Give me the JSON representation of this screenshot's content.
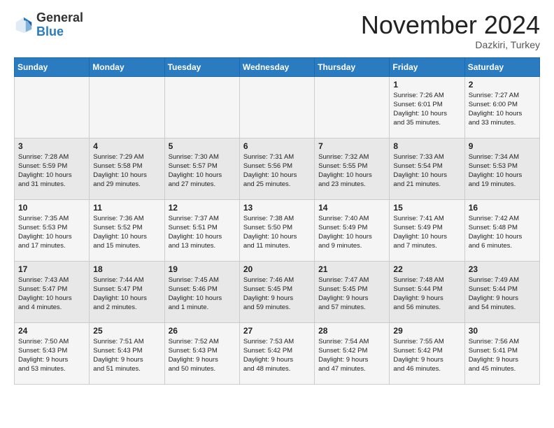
{
  "logo": {
    "general": "General",
    "blue": "Blue"
  },
  "header": {
    "month": "November 2024",
    "location": "Dazkiri, Turkey"
  },
  "weekdays": [
    "Sunday",
    "Monday",
    "Tuesday",
    "Wednesday",
    "Thursday",
    "Friday",
    "Saturday"
  ],
  "weeks": [
    [
      {
        "day": "",
        "info": ""
      },
      {
        "day": "",
        "info": ""
      },
      {
        "day": "",
        "info": ""
      },
      {
        "day": "",
        "info": ""
      },
      {
        "day": "",
        "info": ""
      },
      {
        "day": "1",
        "info": "Sunrise: 7:26 AM\nSunset: 6:01 PM\nDaylight: 10 hours\nand 35 minutes."
      },
      {
        "day": "2",
        "info": "Sunrise: 7:27 AM\nSunset: 6:00 PM\nDaylight: 10 hours\nand 33 minutes."
      }
    ],
    [
      {
        "day": "3",
        "info": "Sunrise: 7:28 AM\nSunset: 5:59 PM\nDaylight: 10 hours\nand 31 minutes."
      },
      {
        "day": "4",
        "info": "Sunrise: 7:29 AM\nSunset: 5:58 PM\nDaylight: 10 hours\nand 29 minutes."
      },
      {
        "day": "5",
        "info": "Sunrise: 7:30 AM\nSunset: 5:57 PM\nDaylight: 10 hours\nand 27 minutes."
      },
      {
        "day": "6",
        "info": "Sunrise: 7:31 AM\nSunset: 5:56 PM\nDaylight: 10 hours\nand 25 minutes."
      },
      {
        "day": "7",
        "info": "Sunrise: 7:32 AM\nSunset: 5:55 PM\nDaylight: 10 hours\nand 23 minutes."
      },
      {
        "day": "8",
        "info": "Sunrise: 7:33 AM\nSunset: 5:54 PM\nDaylight: 10 hours\nand 21 minutes."
      },
      {
        "day": "9",
        "info": "Sunrise: 7:34 AM\nSunset: 5:53 PM\nDaylight: 10 hours\nand 19 minutes."
      }
    ],
    [
      {
        "day": "10",
        "info": "Sunrise: 7:35 AM\nSunset: 5:53 PM\nDaylight: 10 hours\nand 17 minutes."
      },
      {
        "day": "11",
        "info": "Sunrise: 7:36 AM\nSunset: 5:52 PM\nDaylight: 10 hours\nand 15 minutes."
      },
      {
        "day": "12",
        "info": "Sunrise: 7:37 AM\nSunset: 5:51 PM\nDaylight: 10 hours\nand 13 minutes."
      },
      {
        "day": "13",
        "info": "Sunrise: 7:38 AM\nSunset: 5:50 PM\nDaylight: 10 hours\nand 11 minutes."
      },
      {
        "day": "14",
        "info": "Sunrise: 7:40 AM\nSunset: 5:49 PM\nDaylight: 10 hours\nand 9 minutes."
      },
      {
        "day": "15",
        "info": "Sunrise: 7:41 AM\nSunset: 5:49 PM\nDaylight: 10 hours\nand 7 minutes."
      },
      {
        "day": "16",
        "info": "Sunrise: 7:42 AM\nSunset: 5:48 PM\nDaylight: 10 hours\nand 6 minutes."
      }
    ],
    [
      {
        "day": "17",
        "info": "Sunrise: 7:43 AM\nSunset: 5:47 PM\nDaylight: 10 hours\nand 4 minutes."
      },
      {
        "day": "18",
        "info": "Sunrise: 7:44 AM\nSunset: 5:47 PM\nDaylight: 10 hours\nand 2 minutes."
      },
      {
        "day": "19",
        "info": "Sunrise: 7:45 AM\nSunset: 5:46 PM\nDaylight: 10 hours\nand 1 minute."
      },
      {
        "day": "20",
        "info": "Sunrise: 7:46 AM\nSunset: 5:45 PM\nDaylight: 9 hours\nand 59 minutes."
      },
      {
        "day": "21",
        "info": "Sunrise: 7:47 AM\nSunset: 5:45 PM\nDaylight: 9 hours\nand 57 minutes."
      },
      {
        "day": "22",
        "info": "Sunrise: 7:48 AM\nSunset: 5:44 PM\nDaylight: 9 hours\nand 56 minutes."
      },
      {
        "day": "23",
        "info": "Sunrise: 7:49 AM\nSunset: 5:44 PM\nDaylight: 9 hours\nand 54 minutes."
      }
    ],
    [
      {
        "day": "24",
        "info": "Sunrise: 7:50 AM\nSunset: 5:43 PM\nDaylight: 9 hours\nand 53 minutes."
      },
      {
        "day": "25",
        "info": "Sunrise: 7:51 AM\nSunset: 5:43 PM\nDaylight: 9 hours\nand 51 minutes."
      },
      {
        "day": "26",
        "info": "Sunrise: 7:52 AM\nSunset: 5:43 PM\nDaylight: 9 hours\nand 50 minutes."
      },
      {
        "day": "27",
        "info": "Sunrise: 7:53 AM\nSunset: 5:42 PM\nDaylight: 9 hours\nand 48 minutes."
      },
      {
        "day": "28",
        "info": "Sunrise: 7:54 AM\nSunset: 5:42 PM\nDaylight: 9 hours\nand 47 minutes."
      },
      {
        "day": "29",
        "info": "Sunrise: 7:55 AM\nSunset: 5:42 PM\nDaylight: 9 hours\nand 46 minutes."
      },
      {
        "day": "30",
        "info": "Sunrise: 7:56 AM\nSunset: 5:41 PM\nDaylight: 9 hours\nand 45 minutes."
      }
    ]
  ]
}
